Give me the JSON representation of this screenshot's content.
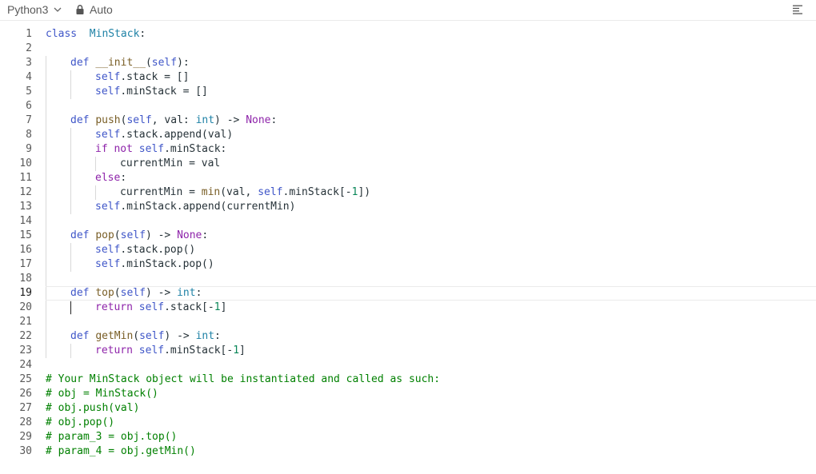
{
  "toolbar": {
    "language": "Python3",
    "mode": "Auto",
    "icons": {
      "language_dropdown": "chevron-down-icon",
      "mode_lock": "lock-icon",
      "menu": "align-left-icon"
    }
  },
  "editor": {
    "active_line": 19,
    "lines": [
      {
        "n": "1",
        "indent": 0,
        "t": [
          [
            "kw",
            "class"
          ],
          [
            "",
            "  "
          ],
          [
            "cls",
            "MinStack"
          ],
          [
            "",
            ":"
          ]
        ]
      },
      {
        "n": "2",
        "indent": 0,
        "t": []
      },
      {
        "n": "3",
        "indent": 1,
        "t": [
          [
            "kw",
            "def"
          ],
          [
            "",
            " "
          ],
          [
            "fn",
            "__init__"
          ],
          [
            "",
            "("
          ],
          [
            "sf",
            "self"
          ],
          [
            "",
            "):"
          ]
        ]
      },
      {
        "n": "4",
        "indent": 2,
        "t": [
          [
            "sf",
            "self"
          ],
          [
            "",
            ".stack = []"
          ]
        ]
      },
      {
        "n": "5",
        "indent": 2,
        "t": [
          [
            "sf",
            "self"
          ],
          [
            "",
            ".minStack = []"
          ]
        ]
      },
      {
        "n": "6",
        "indent": 0,
        "t": []
      },
      {
        "n": "7",
        "indent": 1,
        "t": [
          [
            "kw",
            "def"
          ],
          [
            "",
            " "
          ],
          [
            "fn",
            "push"
          ],
          [
            "",
            "("
          ],
          [
            "sf",
            "self"
          ],
          [
            "",
            ", val: "
          ],
          [
            "ty",
            "int"
          ],
          [
            "",
            ") -> "
          ],
          [
            "kw2",
            "None"
          ],
          [
            "",
            ":"
          ]
        ]
      },
      {
        "n": "8",
        "indent": 2,
        "t": [
          [
            "sf",
            "self"
          ],
          [
            "",
            ".stack.append(val)"
          ]
        ]
      },
      {
        "n": "9",
        "indent": 2,
        "t": [
          [
            "kw2",
            "if"
          ],
          [
            "",
            " "
          ],
          [
            "kw2",
            "not"
          ],
          [
            "",
            " "
          ],
          [
            "sf",
            "self"
          ],
          [
            "",
            ".minStack:"
          ]
        ]
      },
      {
        "n": "10",
        "indent": 3,
        "t": [
          [
            "",
            "currentMin = val"
          ]
        ]
      },
      {
        "n": "11",
        "indent": 2,
        "t": [
          [
            "kw2",
            "else"
          ],
          [
            "",
            ":"
          ]
        ]
      },
      {
        "n": "12",
        "indent": 3,
        "t": [
          [
            "",
            "currentMin = "
          ],
          [
            "fn",
            "min"
          ],
          [
            "",
            "(val, "
          ],
          [
            "sf",
            "self"
          ],
          [
            "",
            ".minStack[-"
          ],
          [
            "nm",
            "1"
          ],
          [
            "",
            "])"
          ]
        ]
      },
      {
        "n": "13",
        "indent": 2,
        "t": [
          [
            "sf",
            "self"
          ],
          [
            "",
            ".minStack.append(currentMin)"
          ]
        ]
      },
      {
        "n": "14",
        "indent": 0,
        "t": []
      },
      {
        "n": "15",
        "indent": 1,
        "t": [
          [
            "kw",
            "def"
          ],
          [
            "",
            " "
          ],
          [
            "fn",
            "pop"
          ],
          [
            "",
            "("
          ],
          [
            "sf",
            "self"
          ],
          [
            "",
            ") -> "
          ],
          [
            "kw2",
            "None"
          ],
          [
            "",
            ":"
          ]
        ]
      },
      {
        "n": "16",
        "indent": 2,
        "t": [
          [
            "sf",
            "self"
          ],
          [
            "",
            ".stack.pop()"
          ]
        ]
      },
      {
        "n": "17",
        "indent": 2,
        "t": [
          [
            "sf",
            "self"
          ],
          [
            "",
            ".minStack.pop()"
          ]
        ]
      },
      {
        "n": "18",
        "indent": 0,
        "t": []
      },
      {
        "n": "19",
        "indent": 1,
        "t": [
          [
            "kw",
            "def"
          ],
          [
            "",
            " "
          ],
          [
            "fn",
            "top"
          ],
          [
            "",
            "("
          ],
          [
            "sf",
            "self"
          ],
          [
            "",
            ") -> "
          ],
          [
            "ty",
            "int"
          ],
          [
            "",
            ":"
          ]
        ]
      },
      {
        "n": "20",
        "indent": 2,
        "t": [
          [
            "kw2",
            "return"
          ],
          [
            "",
            " "
          ],
          [
            "sf",
            "self"
          ],
          [
            "",
            ".stack[-"
          ],
          [
            "nm",
            "1"
          ],
          [
            "",
            "]"
          ]
        ]
      },
      {
        "n": "21",
        "indent": 0,
        "t": []
      },
      {
        "n": "22",
        "indent": 1,
        "t": [
          [
            "kw",
            "def"
          ],
          [
            "",
            " "
          ],
          [
            "fn",
            "getMin"
          ],
          [
            "",
            "("
          ],
          [
            "sf",
            "self"
          ],
          [
            "",
            ") -> "
          ],
          [
            "ty",
            "int"
          ],
          [
            "",
            ":"
          ]
        ]
      },
      {
        "n": "23",
        "indent": 2,
        "t": [
          [
            "kw2",
            "return"
          ],
          [
            "",
            " "
          ],
          [
            "sf",
            "self"
          ],
          [
            "",
            ".minStack[-"
          ],
          [
            "nm",
            "1"
          ],
          [
            "",
            "]"
          ]
        ]
      },
      {
        "n": "24",
        "indent": 0,
        "t": []
      },
      {
        "n": "25",
        "indent": 0,
        "t": [
          [
            "cm",
            "# Your MinStack object will be instantiated and called as such:"
          ]
        ]
      },
      {
        "n": "26",
        "indent": 0,
        "t": [
          [
            "cm",
            "# obj = MinStack()"
          ]
        ]
      },
      {
        "n": "27",
        "indent": 0,
        "t": [
          [
            "cm",
            "# obj.push(val)"
          ]
        ]
      },
      {
        "n": "28",
        "indent": 0,
        "t": [
          [
            "cm",
            "# obj.pop()"
          ]
        ]
      },
      {
        "n": "29",
        "indent": 0,
        "t": [
          [
            "cm",
            "# param_3 = obj.top()"
          ]
        ]
      },
      {
        "n": "30",
        "indent": 0,
        "t": [
          [
            "cm",
            "# param_4 = obj.getMin()"
          ]
        ]
      }
    ]
  }
}
